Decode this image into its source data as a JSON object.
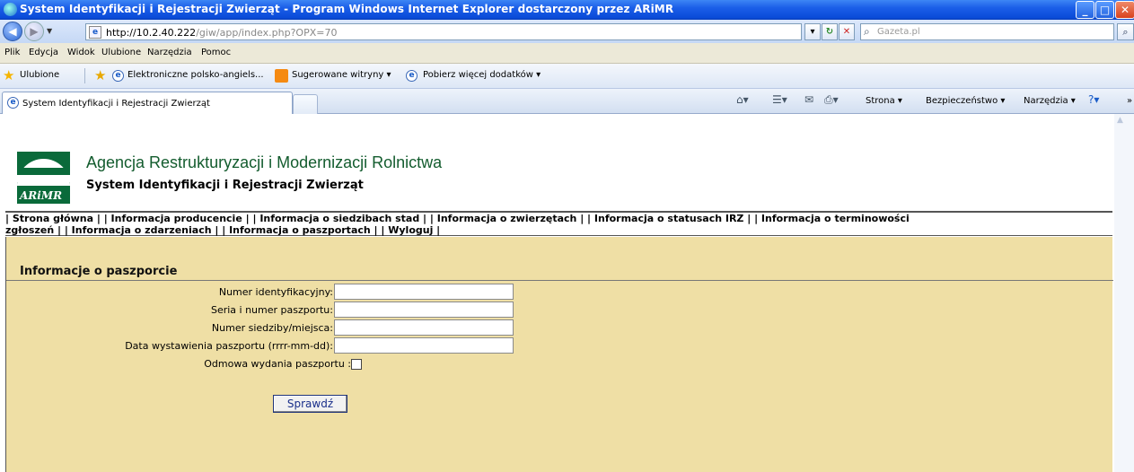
{
  "window": {
    "title": "System Identyfikacji i Rejestracji Zwierząt - Program Windows Internet Explorer dostarczony przez ARiMR"
  },
  "address": {
    "url_host": "http://10.2.40.222",
    "url_path": "/giw/app/index.php?OPX=70",
    "search_placeholder": "Gazeta.pl"
  },
  "menu": [
    "Plik",
    "Edycja",
    "Widok",
    "Ulubione",
    "Narzędzia",
    "Pomoc"
  ],
  "favorites": {
    "ulubione": "Ulubione",
    "items": [
      "Elektroniczne polsko-angiels...",
      "Sugerowane witryny ▾",
      "Pobierz więcej dodatków ▾"
    ]
  },
  "tabs": {
    "active_title": "System Identyfikacji i Rejestracji Zwierząt"
  },
  "toolbar": {
    "strona": "Strona ▾",
    "bezpieczenstwo": "Bezpieczeństwo ▾",
    "narzedzia": "Narzędzia ▾"
  },
  "site": {
    "logo_text": "ARiMR",
    "agency": "Agencja Restrukturyzacji i Modernizacji Rolnictwa",
    "system": "System Identyfikacji i Rejestracji Zwierząt"
  },
  "nav": {
    "row1": "| Strona główna |   | Informacja producencie |   | Informacja o siedzibach stad |   | Informacja o zwierzętach |   | Informacja o statusach IRZ |   | Informacja o terminowości",
    "row2": "zgłoszeń |   | Informacja o zdarzeniach |   | Informacja o paszportach |        | Wyloguj |"
  },
  "form": {
    "heading": "Informacje o paszporcie",
    "fields": [
      {
        "label": "Numer identyfikacyjny:",
        "value": ""
      },
      {
        "label": "Seria i numer paszportu:",
        "value": ""
      },
      {
        "label": "Numer siedziby/miejsca:",
        "value": ""
      },
      {
        "label": "Data wystawienia paszportu (rrrr-mm-dd):",
        "value": ""
      }
    ],
    "checkbox_label": "Odmowa wydania paszportu :",
    "checkbox_checked": false,
    "submit_label": "Sprawdź"
  }
}
